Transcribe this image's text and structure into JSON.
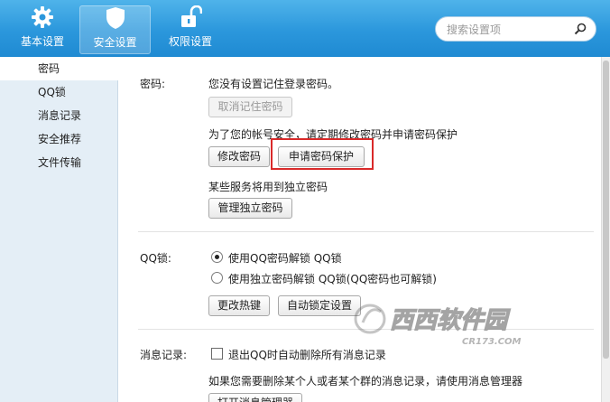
{
  "toolbar": {
    "tabs": [
      {
        "label": "基本设置",
        "icon": "gear-icon"
      },
      {
        "label": "安全设置",
        "icon": "shield-icon"
      },
      {
        "label": "权限设置",
        "icon": "unlock-icon"
      }
    ],
    "active_tab": "安全设置",
    "search_placeholder": "搜索设置项"
  },
  "sidebar": {
    "items": [
      {
        "label": "密码"
      },
      {
        "label": "QQ锁"
      },
      {
        "label": "消息记录"
      },
      {
        "label": "安全推荐"
      },
      {
        "label": "文件传输"
      }
    ],
    "active_item": "密码"
  },
  "password": {
    "section_label": "密码:",
    "status": "您没有设置记住登录密码。",
    "cancel_remember_button": "取消记住密码",
    "advice": "为了您的帐号安全，请定期修改密码并申请密码保护",
    "change_password_button": "修改密码",
    "apply_protection_button": "申请密码保护",
    "independent_note": "某些服务将用到独立密码",
    "manage_independent_button": "管理独立密码"
  },
  "qqlock": {
    "section_label": "QQ锁:",
    "option1": "使用QQ密码解锁 QQ锁",
    "option2": "使用独立密码解锁 QQ锁(QQ密码也可解锁)",
    "selected_option": 1,
    "change_hotkey_button": "更改热键",
    "auto_lock_button": "自动锁定设置"
  },
  "messages": {
    "section_label": "消息记录:",
    "checkbox_label": "退出QQ时自动删除所有消息记录",
    "checkbox_checked": false,
    "note": "如果您需要删除某个人或者某个群的消息记录，请使用消息管理器",
    "open_manager_button": "打开消息管理器"
  },
  "watermark": {
    "text": "西西软件园",
    "subtext": "CR173.COM"
  },
  "colors": {
    "toolbar_blue": "#2b97dc",
    "highlight_red": "#d92a2a",
    "sidebar_bg": "#e4eef6"
  }
}
